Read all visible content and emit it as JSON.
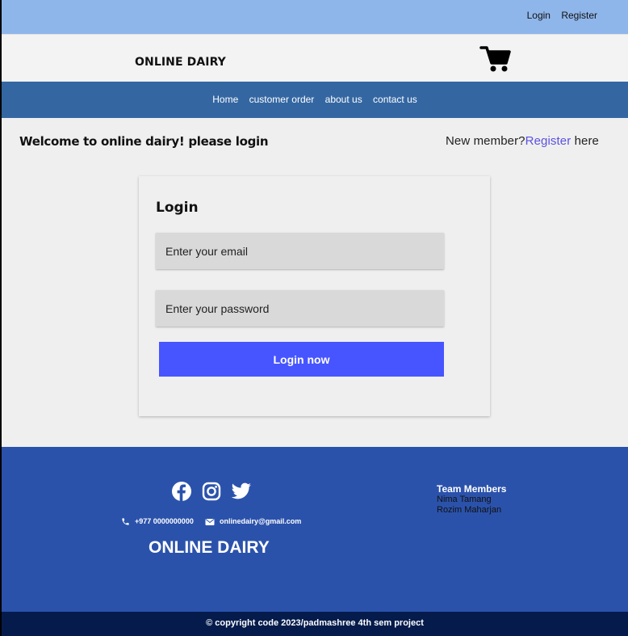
{
  "top_nav": {
    "login": "Login",
    "register": "Register"
  },
  "brand": {
    "name": "ONLINE DAIRY",
    "cart_icon": "cart-icon"
  },
  "main_nav": {
    "items": [
      "Home",
      "customer order",
      "about us",
      "contact us"
    ]
  },
  "welcome": {
    "message": "Welcome to online dairy! please login",
    "new_member_prefix": "New member?",
    "register_link": "Register",
    "new_member_suffix": " here"
  },
  "login_form": {
    "title": "Login",
    "email_placeholder": "Enter your email",
    "password_placeholder": "Enter your password",
    "submit_label": "Login now"
  },
  "footer": {
    "social_icons": [
      "facebook-icon",
      "instagram-icon",
      "twitter-icon"
    ],
    "phone": "+977 0000000000",
    "email": "onlinedairy@gmail.com",
    "brand": "ONLINE DAIRY",
    "team_title": "Team Members",
    "team_members": [
      "Nima Tamang",
      "Rozim Maharjan"
    ],
    "copyright": "© copyright code 2023/padmashree 4th sem project"
  },
  "colors": {
    "top_bar": "#8fb6ea",
    "nav_bar": "#3467a2",
    "accent_button": "#4655ff",
    "link": "#5a52e0",
    "footer": "#2b52ab",
    "copyright_bar": "#051b4c"
  }
}
